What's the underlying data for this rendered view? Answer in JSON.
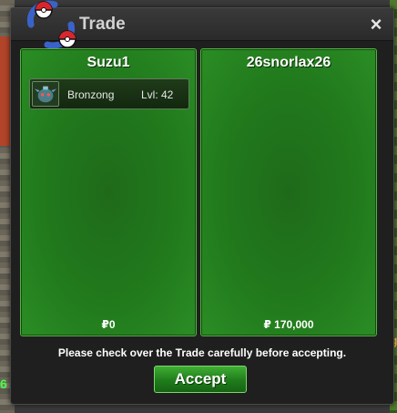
{
  "window": {
    "title": "Trade",
    "close_glyph": "×",
    "logo_icon": "pokeball-swirl-icon"
  },
  "left_panel": {
    "player_name": "Suzu1",
    "pokemon": [
      {
        "name": "Bronzong",
        "level": "Lvl: 42",
        "icon": "bronzong-sprite-icon"
      }
    ],
    "money": "₽0"
  },
  "right_panel": {
    "player_name": "26snorlax26",
    "pokemon": [],
    "money": "₽ 170,000"
  },
  "footer": {
    "notice": "Please check over the Trade carefully before accepting.",
    "accept_label": "Accept"
  },
  "background": {
    "left_number": "6",
    "right_text": "g"
  },
  "colors": {
    "panel_green": "#217a1c",
    "panel_border": "#57b046",
    "button_green": "#207c1b",
    "window_bg": "#1f1f1f"
  }
}
